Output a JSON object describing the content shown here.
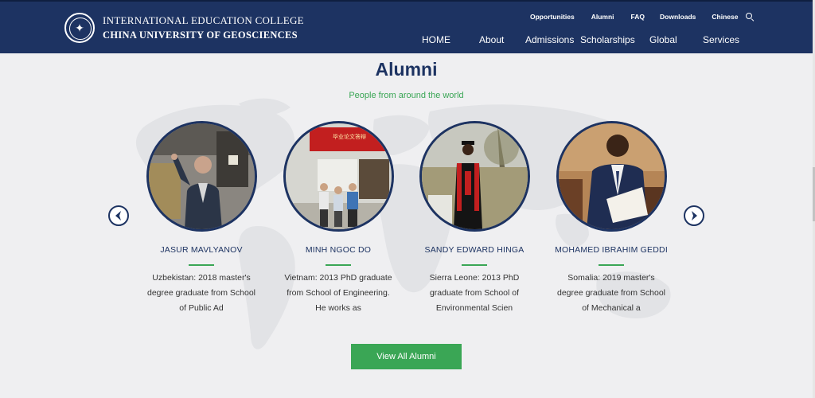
{
  "header": {
    "logo_line1": "INTERNATIONAL EDUCATION COLLEGE",
    "logo_line2": "CHINA UNIVERSITY OF GEOSCIENCES",
    "top_links": [
      "Opportunities",
      "Alumni",
      "FAQ",
      "Downloads",
      "Chinese"
    ],
    "nav": [
      "HOME",
      "About",
      "Admissions",
      "Scholarships",
      "Global",
      "Services"
    ]
  },
  "section": {
    "title": "Alumni",
    "subtitle": "People from around the world",
    "button": "View All Alumni"
  },
  "alumni": [
    {
      "name": "JASUR MAVLYANOV",
      "desc_lines": [
        "Uzbekistan: 2018 master's",
        "degree graduate from School",
        "of Public Ad"
      ]
    },
    {
      "name": "MINH NGOC DO",
      "desc_lines": [
        "Vietnam: 2013 PhD graduate",
        "from School of Engineering.",
        "He works as"
      ]
    },
    {
      "name": "SANDY EDWARD HINGA",
      "desc_lines": [
        "Sierra Leone: 2013 PhD",
        "graduate from School of",
        "Environmental Scien"
      ]
    },
    {
      "name": "MOHAMED IBRAHIM GEDDI",
      "desc_lines": [
        "Somalia: 2019 master's",
        "degree graduate from School",
        "of Mechanical a"
      ]
    }
  ],
  "photo_banner_text": "毕业论文答辩",
  "colors": {
    "navy": "#1d3362",
    "green": "#3aa655",
    "background": "#efeff1"
  },
  "icons": [
    "search-icon",
    "arrow-left-icon",
    "arrow-right-icon",
    "college-seal-logo"
  ]
}
